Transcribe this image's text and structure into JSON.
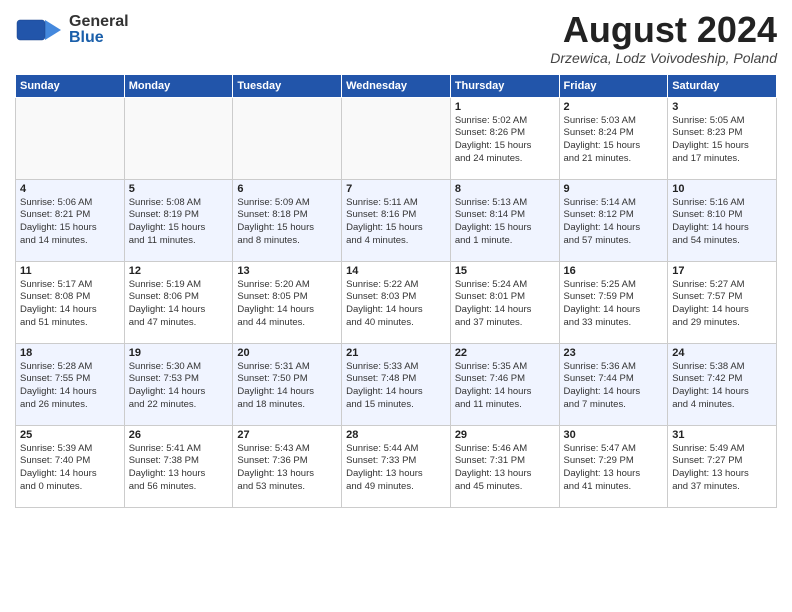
{
  "header": {
    "logo_general": "General",
    "logo_blue": "Blue",
    "month_title": "August 2024",
    "location": "Drzewica, Lodz Voivodeship, Poland"
  },
  "days_of_week": [
    "Sunday",
    "Monday",
    "Tuesday",
    "Wednesday",
    "Thursday",
    "Friday",
    "Saturday"
  ],
  "weeks": [
    [
      {
        "day": "",
        "info": ""
      },
      {
        "day": "",
        "info": ""
      },
      {
        "day": "",
        "info": ""
      },
      {
        "day": "",
        "info": ""
      },
      {
        "day": "1",
        "info": "Sunrise: 5:02 AM\nSunset: 8:26 PM\nDaylight: 15 hours\nand 24 minutes."
      },
      {
        "day": "2",
        "info": "Sunrise: 5:03 AM\nSunset: 8:24 PM\nDaylight: 15 hours\nand 21 minutes."
      },
      {
        "day": "3",
        "info": "Sunrise: 5:05 AM\nSunset: 8:23 PM\nDaylight: 15 hours\nand 17 minutes."
      }
    ],
    [
      {
        "day": "4",
        "info": "Sunrise: 5:06 AM\nSunset: 8:21 PM\nDaylight: 15 hours\nand 14 minutes."
      },
      {
        "day": "5",
        "info": "Sunrise: 5:08 AM\nSunset: 8:19 PM\nDaylight: 15 hours\nand 11 minutes."
      },
      {
        "day": "6",
        "info": "Sunrise: 5:09 AM\nSunset: 8:18 PM\nDaylight: 15 hours\nand 8 minutes."
      },
      {
        "day": "7",
        "info": "Sunrise: 5:11 AM\nSunset: 8:16 PM\nDaylight: 15 hours\nand 4 minutes."
      },
      {
        "day": "8",
        "info": "Sunrise: 5:13 AM\nSunset: 8:14 PM\nDaylight: 15 hours\nand 1 minute."
      },
      {
        "day": "9",
        "info": "Sunrise: 5:14 AM\nSunset: 8:12 PM\nDaylight: 14 hours\nand 57 minutes."
      },
      {
        "day": "10",
        "info": "Sunrise: 5:16 AM\nSunset: 8:10 PM\nDaylight: 14 hours\nand 54 minutes."
      }
    ],
    [
      {
        "day": "11",
        "info": "Sunrise: 5:17 AM\nSunset: 8:08 PM\nDaylight: 14 hours\nand 51 minutes."
      },
      {
        "day": "12",
        "info": "Sunrise: 5:19 AM\nSunset: 8:06 PM\nDaylight: 14 hours\nand 47 minutes."
      },
      {
        "day": "13",
        "info": "Sunrise: 5:20 AM\nSunset: 8:05 PM\nDaylight: 14 hours\nand 44 minutes."
      },
      {
        "day": "14",
        "info": "Sunrise: 5:22 AM\nSunset: 8:03 PM\nDaylight: 14 hours\nand 40 minutes."
      },
      {
        "day": "15",
        "info": "Sunrise: 5:24 AM\nSunset: 8:01 PM\nDaylight: 14 hours\nand 37 minutes."
      },
      {
        "day": "16",
        "info": "Sunrise: 5:25 AM\nSunset: 7:59 PM\nDaylight: 14 hours\nand 33 minutes."
      },
      {
        "day": "17",
        "info": "Sunrise: 5:27 AM\nSunset: 7:57 PM\nDaylight: 14 hours\nand 29 minutes."
      }
    ],
    [
      {
        "day": "18",
        "info": "Sunrise: 5:28 AM\nSunset: 7:55 PM\nDaylight: 14 hours\nand 26 minutes."
      },
      {
        "day": "19",
        "info": "Sunrise: 5:30 AM\nSunset: 7:53 PM\nDaylight: 14 hours\nand 22 minutes."
      },
      {
        "day": "20",
        "info": "Sunrise: 5:31 AM\nSunset: 7:50 PM\nDaylight: 14 hours\nand 18 minutes."
      },
      {
        "day": "21",
        "info": "Sunrise: 5:33 AM\nSunset: 7:48 PM\nDaylight: 14 hours\nand 15 minutes."
      },
      {
        "day": "22",
        "info": "Sunrise: 5:35 AM\nSunset: 7:46 PM\nDaylight: 14 hours\nand 11 minutes."
      },
      {
        "day": "23",
        "info": "Sunrise: 5:36 AM\nSunset: 7:44 PM\nDaylight: 14 hours\nand 7 minutes."
      },
      {
        "day": "24",
        "info": "Sunrise: 5:38 AM\nSunset: 7:42 PM\nDaylight: 14 hours\nand 4 minutes."
      }
    ],
    [
      {
        "day": "25",
        "info": "Sunrise: 5:39 AM\nSunset: 7:40 PM\nDaylight: 14 hours\nand 0 minutes."
      },
      {
        "day": "26",
        "info": "Sunrise: 5:41 AM\nSunset: 7:38 PM\nDaylight: 13 hours\nand 56 minutes."
      },
      {
        "day": "27",
        "info": "Sunrise: 5:43 AM\nSunset: 7:36 PM\nDaylight: 13 hours\nand 53 minutes."
      },
      {
        "day": "28",
        "info": "Sunrise: 5:44 AM\nSunset: 7:33 PM\nDaylight: 13 hours\nand 49 minutes."
      },
      {
        "day": "29",
        "info": "Sunrise: 5:46 AM\nSunset: 7:31 PM\nDaylight: 13 hours\nand 45 minutes."
      },
      {
        "day": "30",
        "info": "Sunrise: 5:47 AM\nSunset: 7:29 PM\nDaylight: 13 hours\nand 41 minutes."
      },
      {
        "day": "31",
        "info": "Sunrise: 5:49 AM\nSunset: 7:27 PM\nDaylight: 13 hours\nand 37 minutes."
      }
    ]
  ]
}
